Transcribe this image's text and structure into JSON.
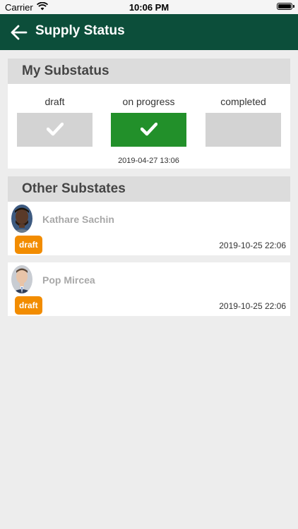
{
  "statusbar": {
    "carrier": "Carrier",
    "time": "10:06 PM"
  },
  "navbar": {
    "back_icon": "back-arrow-icon",
    "title": "Supply Status"
  },
  "my_substatus": {
    "header": "My Substatus",
    "steps": [
      {
        "label": "draft",
        "checked": true,
        "active": false
      },
      {
        "label": "on progress",
        "checked": true,
        "active": true
      },
      {
        "label": "completed",
        "checked": false,
        "active": false
      }
    ],
    "date": "2019-04-27 13:06"
  },
  "other_substates": {
    "header": "Other Substates",
    "entries": [
      {
        "name": "Kathare Sachin",
        "badge": "draft",
        "date": "2019-10-25 22:06"
      },
      {
        "name": "Pop Mircea",
        "badge": "draft",
        "date": "2019-10-25 22:06"
      }
    ]
  },
  "colors": {
    "navbar": "#0c4e3a",
    "active_step": "#22902a",
    "inactive_step": "#d3d3d3",
    "badge": "#f28c00",
    "header_bg": "#dcdcdc",
    "page_bg": "#ededed"
  }
}
